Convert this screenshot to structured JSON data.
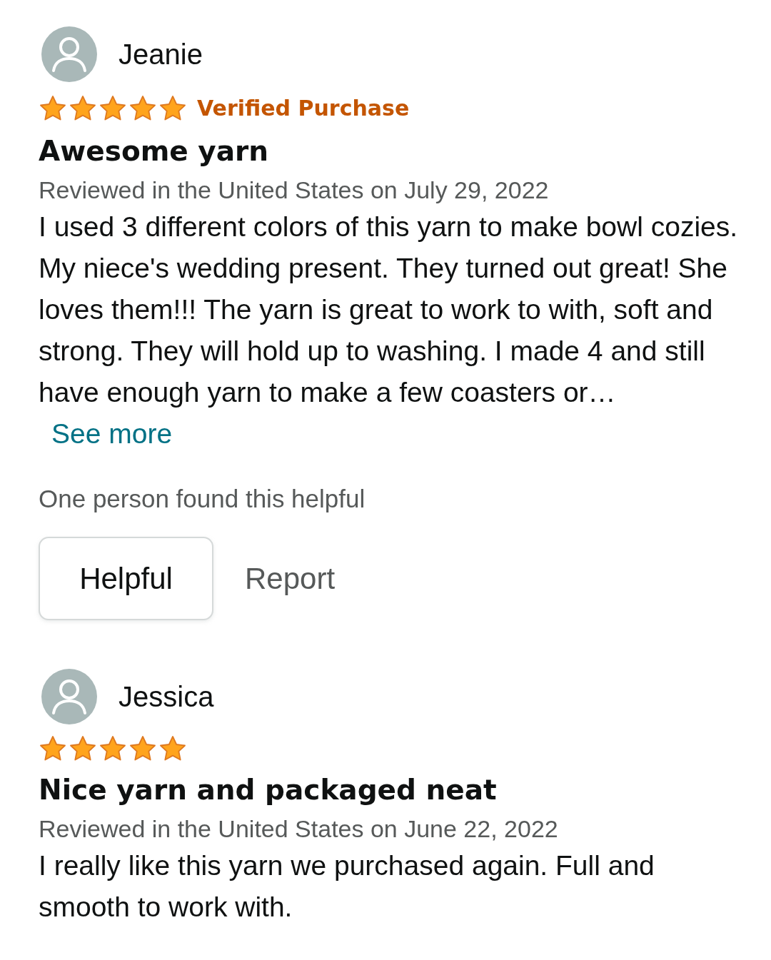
{
  "reviews": [
    {
      "name": "Jeanie",
      "stars": 5,
      "badge": "Verified Purchase",
      "title": "Awesome yarn",
      "date": "Reviewed in the United States on July 29, 2022",
      "body": "I used 3 different colors of this yarn to make bowl cozies. My niece's wedding present. They turned out great! She loves them!!! The yarn is great to work to with, soft and strong. They will hold up to washing. I made 4 and still have enough yarn to make a few coasters or…",
      "see_more": "See more",
      "helpful_note": "One person found this helpful",
      "helpful_button": "Helpful",
      "report_link": "Report"
    },
    {
      "name": "Jessica",
      "stars": 5,
      "title": "Nice yarn and packaged neat",
      "date": "Reviewed in the United States on June 22, 2022",
      "body": "I really like this yarn we purchased again. Full and smooth to work with."
    }
  ]
}
